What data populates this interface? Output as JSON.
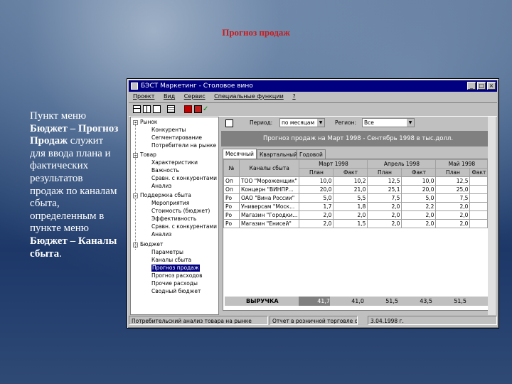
{
  "slide": {
    "title": "Прогноз продаж",
    "side_text_parts": [
      {
        "text": "Пункт меню ",
        "bold": false
      },
      {
        "text": "Бюджет – Прогноз Продаж",
        "bold": true
      },
      {
        "text": " служит для ввода плана и фактических результатов продаж по каналам сбыта, определенным в пункте меню ",
        "bold": false
      },
      {
        "text": "Бюджет – Каналы сбыта",
        "bold": true
      },
      {
        "text": ".",
        "bold": false
      }
    ]
  },
  "window": {
    "title": "БЭСТ Маркетинг - Столовое вино",
    "controls": [
      "_",
      "□",
      "×"
    ],
    "menu": [
      "Проект",
      "Вид",
      "Сервис",
      "Специальные функции",
      "?"
    ]
  },
  "tree": {
    "groups": [
      {
        "label": "Рынок",
        "items": [
          "Конкуренты",
          "Сегментирование",
          "Потребители на рынке"
        ]
      },
      {
        "label": "Товар",
        "items": [
          "Характеристики",
          "Важность",
          "Сравн. с конкурентами",
          "Анализ"
        ]
      },
      {
        "label": "Поддержка сбыта",
        "items": [
          "Мероприятия",
          "Стоимость (бюджет)",
          "Эффективность",
          "Сравн. с конкурентами",
          "Анализ"
        ]
      },
      {
        "label": "Бюджет",
        "items": [
          "Параметры",
          "Каналы сбыта",
          "Прогноз продаж",
          "Прогноз расходов",
          "Прочие расходы",
          "Сводный бюджет"
        ]
      }
    ],
    "selected": "Прогноз продаж"
  },
  "filters": {
    "period_label": "Период:",
    "period_value": "по месяцам",
    "region_label": "Регион:",
    "region_value": "Все"
  },
  "banner": "Прогноз продаж на Март 1998 - Сентябрь 1998 в тыс.долл.",
  "tabs": [
    "Месячный",
    "Квартальный",
    "Годовой"
  ],
  "grid": {
    "col_n": "№",
    "col_channel": "Каналы сбыта",
    "months": [
      "Март 1998",
      "Апрель 1998",
      "Май 1998"
    ],
    "plan": "План",
    "fact": "Факт",
    "rows": [
      {
        "n": "Оп",
        "channel": "ТОО \"Мороженщик\"",
        "values": [
          "10,0",
          "10,2",
          "12,5",
          "10,0",
          "12,5"
        ]
      },
      {
        "n": "Оп",
        "channel": "Концерн \"ВИНПР...",
        "values": [
          "20,0",
          "21,0",
          "25,1",
          "20,0",
          "25,0"
        ]
      },
      {
        "n": "Ро",
        "channel": "ОАО \"Вина России\"",
        "values": [
          "5,0",
          "5,5",
          "7,5",
          "5,0",
          "7,5"
        ]
      },
      {
        "n": "Ро",
        "channel": "Универсам \"Моск...",
        "values": [
          "1,7",
          "1,8",
          "2,0",
          "2,2",
          "2,0"
        ]
      },
      {
        "n": "Ро",
        "channel": "Магазин \"Городки...",
        "values": [
          "2,0",
          "2,0",
          "2,0",
          "2,0",
          "2,0"
        ]
      },
      {
        "n": "Ро",
        "channel": "Магазин \"Енисей\"",
        "values": [
          "2,0",
          "1,5",
          "2,0",
          "2,0",
          "2,0"
        ]
      }
    ],
    "total_label": "ВЫРУЧКА",
    "totals": [
      "41,7",
      "41,0",
      "51,5",
      "43,5",
      "51,5"
    ]
  },
  "status": [
    "Потребительский анализ товара на рынке",
    "Отчет в розничной торговле о...",
    "3.04.1998 г."
  ]
}
